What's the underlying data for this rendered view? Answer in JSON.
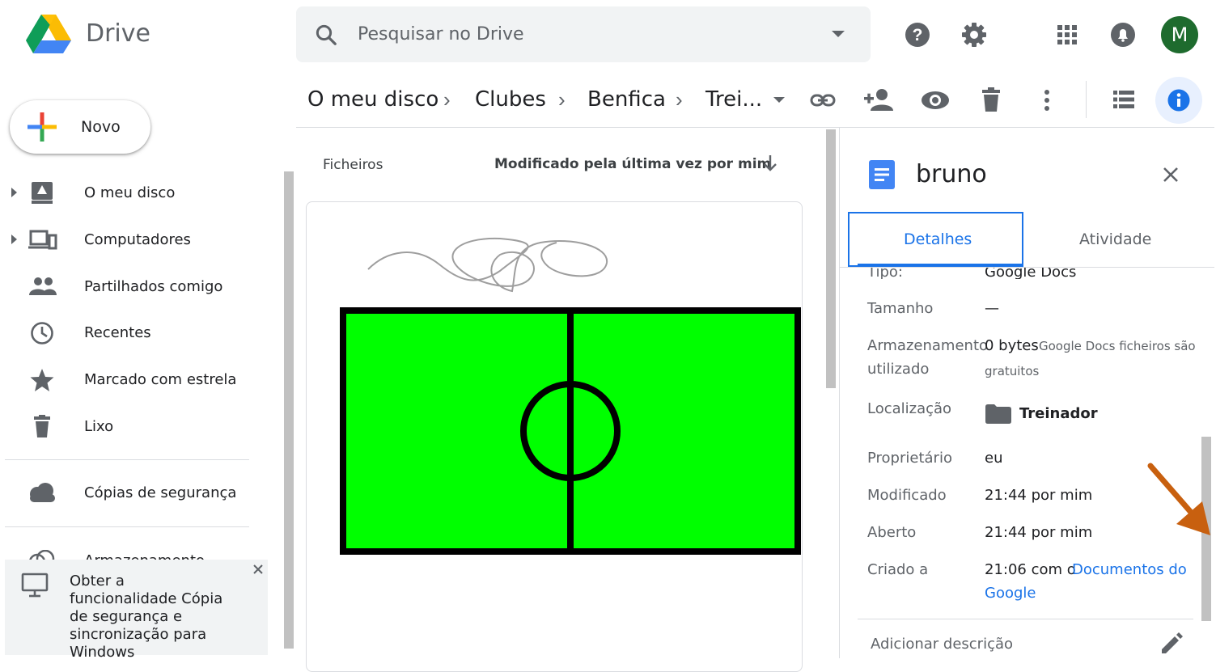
{
  "app": {
    "name": "Drive"
  },
  "search": {
    "placeholder": "Pesquisar no Drive"
  },
  "account": {
    "avatar_letter": "M",
    "avatar_color": "#1e6b2e"
  },
  "breadcrumb": {
    "items": [
      "O meu disco",
      "Clubes",
      "Benfica",
      "Trei..."
    ]
  },
  "sidebar": {
    "new_label": "Novo",
    "items": [
      {
        "label": "O meu disco",
        "icon": "drive-icon"
      },
      {
        "label": "Computadores",
        "icon": "computers-icon"
      },
      {
        "label": "Partilhados comigo",
        "icon": "shared-icon"
      },
      {
        "label": "Recentes",
        "icon": "clock-icon"
      },
      {
        "label": "Marcado com estrela",
        "icon": "star-icon"
      },
      {
        "label": "Lixo",
        "icon": "trash-icon"
      },
      {
        "label": "Cópias de segurança",
        "icon": "cloud-icon"
      },
      {
        "label": "Armazenamento",
        "icon": "cloud-outline-icon"
      }
    ],
    "promo_text": "Obter a funcionalidade Cópia de segurança e sincronização para Windows"
  },
  "files": {
    "section_label": "Ficheiros",
    "sort_label": "Modificado pela última vez por mim"
  },
  "details": {
    "file_name": "bruno",
    "tabs": [
      "Detalhes",
      "Atividade"
    ],
    "active_tab": "Detalhes",
    "partial_row": {
      "label": "Tipo:",
      "value": "Google Docs"
    },
    "size_label": "Tamanho",
    "size_value": "—",
    "storage_label_1": "Armazenamento",
    "storage_label_2": "utilizado",
    "storage_value": "0 bytes",
    "storage_note_1": "Google Docs ficheiros são",
    "storage_note_2": "gratuitos",
    "location_label": "Localização",
    "location_value": "Treinador",
    "owner_label": "Proprietário",
    "owner_value": "eu",
    "modified_label": "Modificado",
    "modified_value": "21:44 por mim",
    "opened_label": "Aberto",
    "opened_value": "21:44 por mim",
    "created_label": "Criado a",
    "created_value": "21:06 com o",
    "created_link_1": "Documentos do",
    "created_link_2": "Google",
    "description_placeholder": "Adicionar descrição"
  },
  "colors": {
    "accent": "#1a73e8",
    "field_green": "#00ff00",
    "annotation_arrow": "#c8600f"
  }
}
